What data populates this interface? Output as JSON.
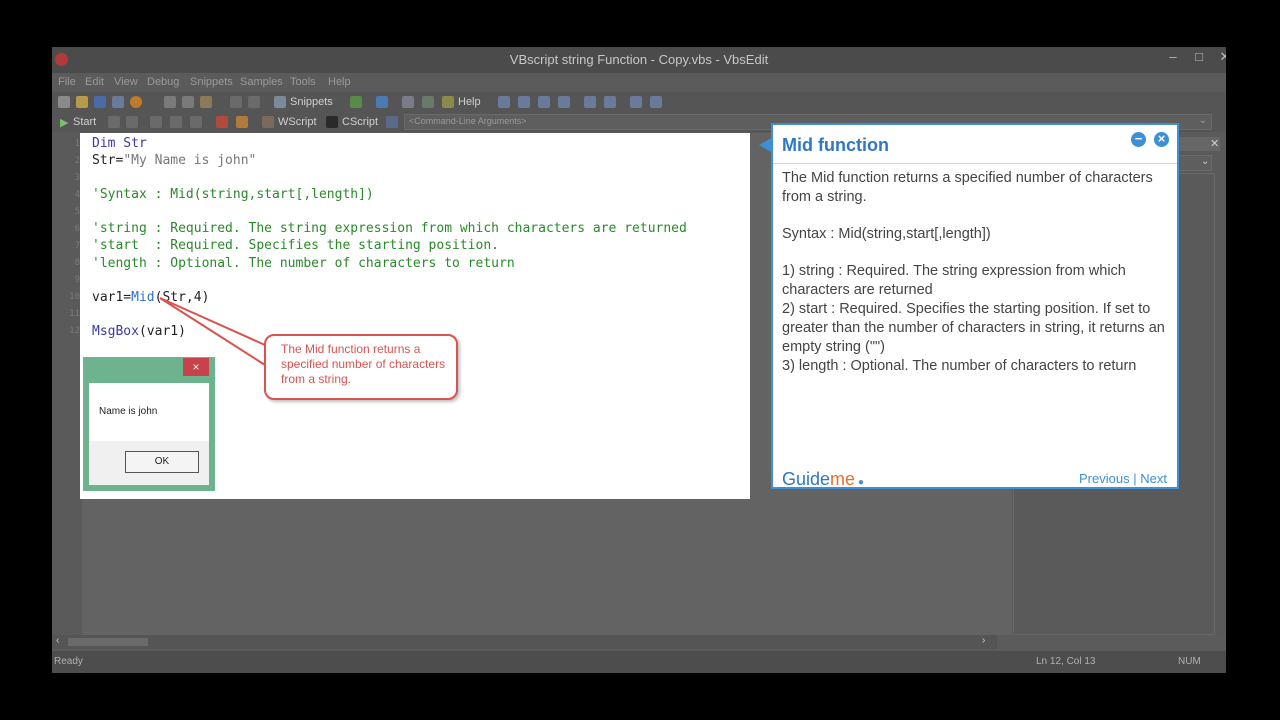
{
  "window": {
    "title": "VBscript string Function - Copy.vbs - VbsEdit"
  },
  "menu": [
    "File",
    "Edit",
    "View",
    "Debug",
    "Snippets",
    "Samples",
    "Tools",
    "Help"
  ],
  "toolbar": {
    "snippets": "Snippets",
    "help": "Help",
    "start": "Start",
    "wscript": "WScript",
    "cscript": "CScript",
    "args": "<Command-Line Arguments>"
  },
  "line_numbers": [
    "1",
    "2",
    "3",
    "4",
    "5",
    "6",
    "7",
    "8",
    "9",
    "10",
    "11",
    "12"
  ],
  "code": {
    "l1": "Dim Str",
    "l2a": "Str=",
    "l2b": "\"My Name is john\"",
    "l4": "'Syntax : Mid(string,start[,length])",
    "l6": "'string : Required. The string expression from which characters are returned",
    "l7": "'start  : Required. Specifies the starting position.",
    "l8": "'length : Optional. The number of characters to return",
    "l10a": "var1=",
    "l10b": "Mid",
    "l10c": "(Str,4)",
    "l12a": "MsgBox",
    "l12b": "(var1)"
  },
  "msgbox": {
    "text": "Name is john",
    "ok": "OK",
    "close": "×"
  },
  "callout": {
    "text": "The Mid function returns a specified number of characters from a string."
  },
  "guide": {
    "title": "Mid function",
    "p1": "The Mid function returns a specified number of characters from a string.",
    "p2": "Syntax : Mid(string,start[,length])",
    "p3": "1) string : Required. The string expression from which characters are returned",
    "p4": "2) start : Required. Specifies the starting position. If set to greater than the number of characters in string, it returns an empty string (\"\")",
    "p5": "3) length : Optional. The number of characters to return",
    "brand": "Guide",
    "brand2": "me",
    "prev": "Previous",
    "sep": "|",
    "next": "Next",
    "minimize": "−",
    "close": "×"
  },
  "status": {
    "left": "Ready",
    "position": "Ln 12, Col 13",
    "num": "NUM"
  },
  "colors": {
    "guide_accent": "#3d8fd6",
    "callout": "#d9534f",
    "brand_orange": "#e8702a"
  }
}
